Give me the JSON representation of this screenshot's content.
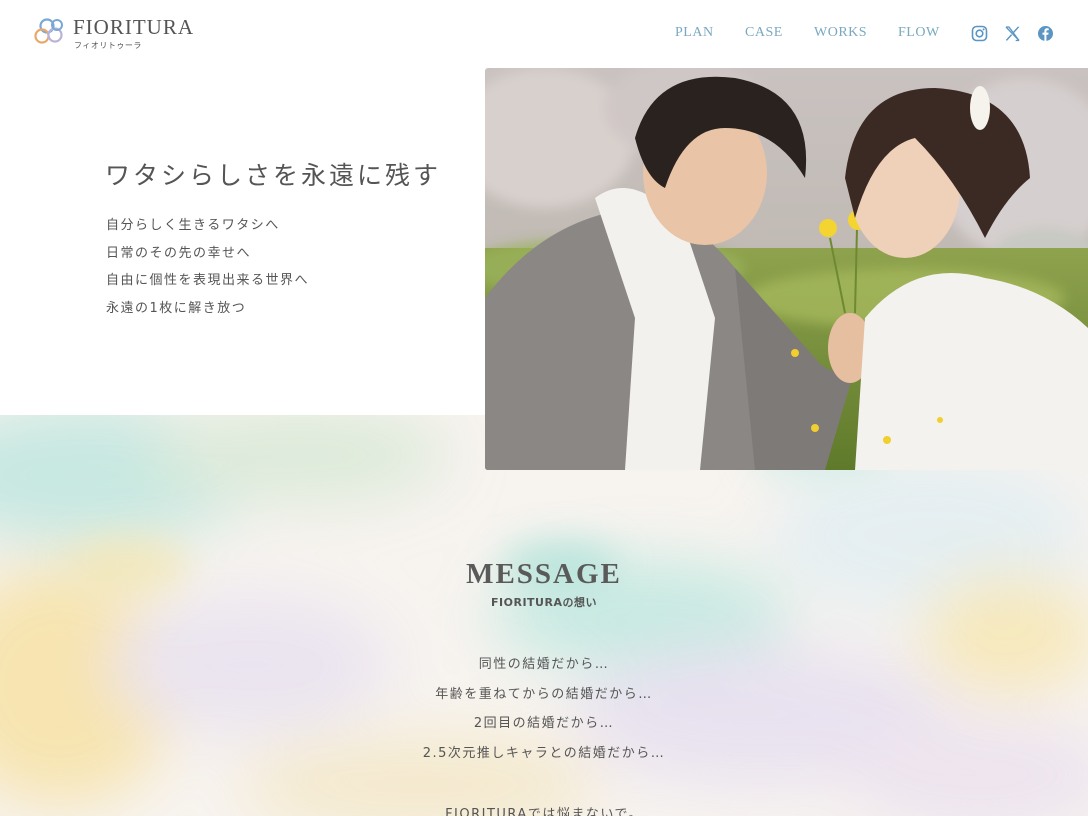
{
  "brand": {
    "name": "FIORITURA",
    "kana": "フィオリトゥーラ",
    "logo_colors": [
      "#7aa8d6",
      "#e9a86a",
      "#b9b3d9"
    ]
  },
  "nav": {
    "items": [
      "PLAN",
      "CASE",
      "WORKS",
      "FLOW"
    ],
    "color": "#7aa8c0"
  },
  "social": {
    "icons": [
      "instagram-icon",
      "x-icon",
      "facebook-icon"
    ]
  },
  "hero": {
    "title": "ワタシらしさを永遠に残す",
    "lines": [
      "自分らしく生きるワタシへ",
      "日常のその先の幸せへ",
      "自由に個性を表現出来る世界へ",
      "永遠の1枚に解き放つ"
    ],
    "photo": "wedding-couple-photo"
  },
  "message": {
    "title": "MESSAGE",
    "subtitle": "FIORITURAの想い",
    "lines": [
      "同性の結婚だから…",
      "年齢を重ねてからの結婚だから…",
      "2回目の結婚だから…",
      "2.5次元推しキャラとの結婚だから…"
    ],
    "closing": "FIORITURAでは悩まないで。"
  }
}
